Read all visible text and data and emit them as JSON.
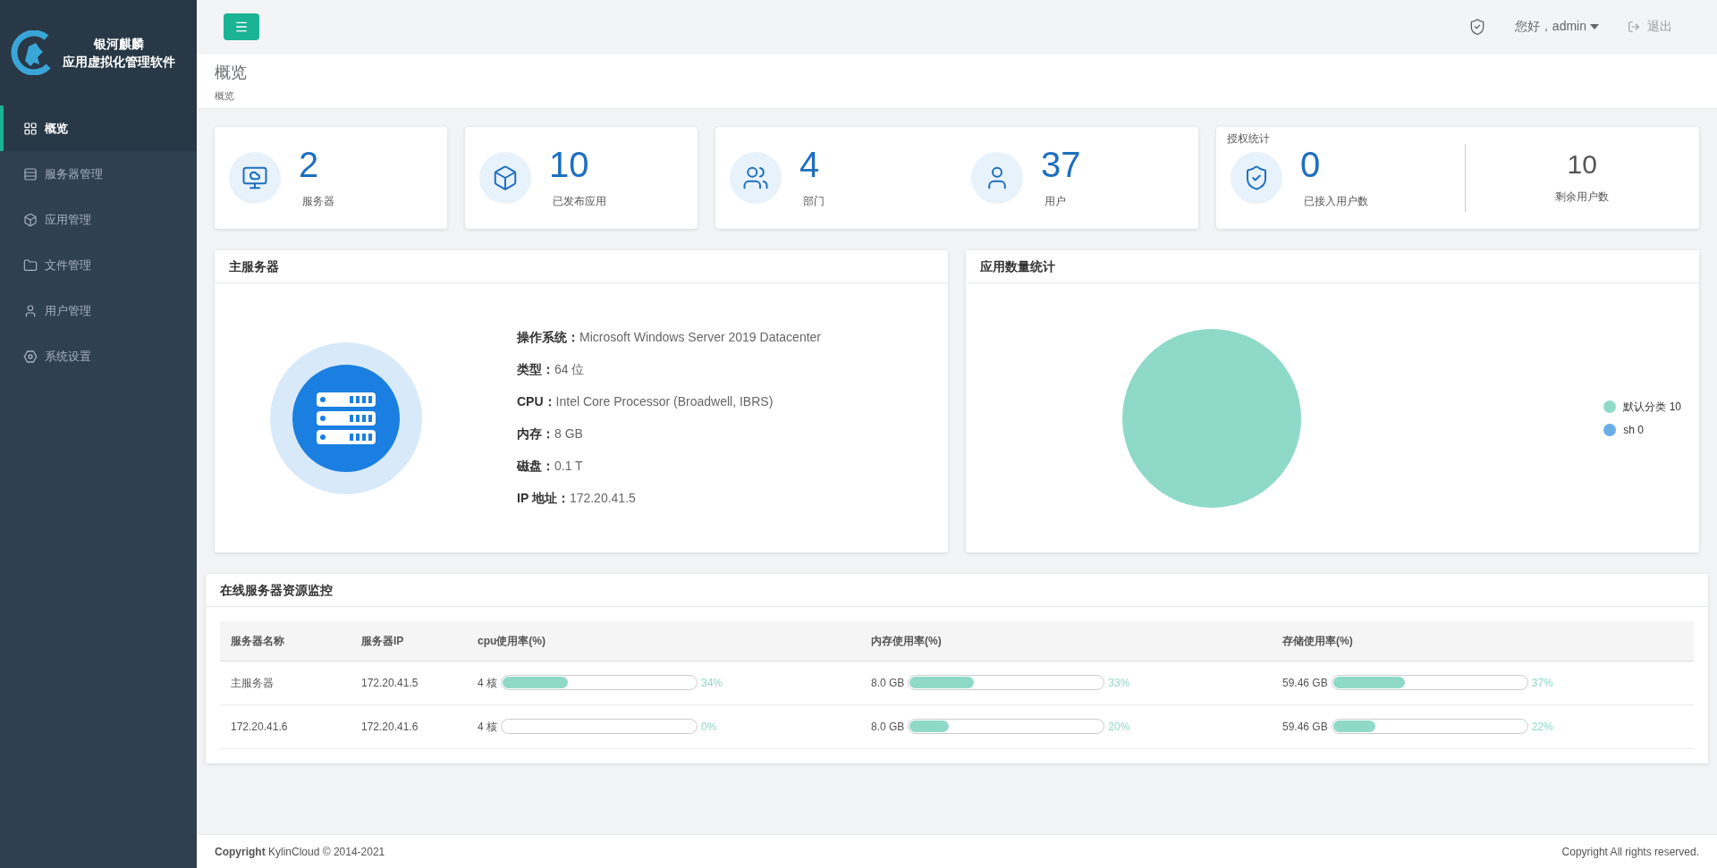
{
  "sidebar": {
    "brand_line_1": "银河麒麟",
    "brand_line_2": "应用虚拟化管理软件",
    "items": [
      {
        "label": "概览",
        "kind": "overview",
        "selected": true
      },
      {
        "label": "服务器管理",
        "kind": "server",
        "selected": false
      },
      {
        "label": "应用管理",
        "kind": "app",
        "selected": false
      },
      {
        "label": "文件管理",
        "kind": "file",
        "selected": false
      },
      {
        "label": "用户管理",
        "kind": "user",
        "selected": false
      },
      {
        "label": "系统设置",
        "kind": "settings",
        "selected": false
      }
    ]
  },
  "header": {
    "greeting": "您好，admin",
    "logout": "退出"
  },
  "page": {
    "title": "概览",
    "breadcrumb": "概览"
  },
  "stat_cards": [
    {
      "items": [
        {
          "kind": "server",
          "value": "2",
          "label": "服务器"
        }
      ]
    },
    {
      "items": [
        {
          "kind": "app",
          "value": "10",
          "label": "已发布应用"
        }
      ]
    },
    {
      "items": [
        {
          "kind": "department",
          "value": "4",
          "label": "部门"
        },
        {
          "kind": "user",
          "value": "37",
          "label": "用户"
        }
      ]
    },
    {
      "title": "授权统计",
      "items": [
        {
          "kind": "license",
          "value": "0",
          "label": "已接入用户数"
        },
        {
          "kind": "plain",
          "value": "10",
          "label": "剩余用户数"
        }
      ]
    }
  ],
  "main_server": {
    "title": "主服务器",
    "fields": [
      {
        "label": "操作系统：",
        "value": "Microsoft Windows Server 2019 Datacenter"
      },
      {
        "label": "类型：",
        "value": "64 位"
      },
      {
        "label": "CPU：",
        "value": "Intel Core Processor (Broadwell, IBRS)"
      },
      {
        "label": "内存：",
        "value": "8 GB"
      },
      {
        "label": "磁盘：",
        "value": "0.1 T"
      },
      {
        "label": "IP 地址：",
        "value": "172.20.41.5"
      }
    ]
  },
  "app_stats": {
    "title": "应用数量统计",
    "legend": [
      {
        "label": "默认分类 10",
        "color": "#8fd9c8"
      },
      {
        "label": "sh 0",
        "color": "#6aaee6"
      }
    ]
  },
  "monitor": {
    "title": "在线服务器资源监控",
    "columns": [
      "服务器名称",
      "服务器IP",
      "cpu使用率(%)",
      "内存使用率(%)",
      "存储使用率(%)"
    ],
    "rows": [
      {
        "name": "主服务器",
        "ip": "172.20.41.5",
        "meters": [
          {
            "amount": "4 核",
            "level": 0.34,
            "percent": "34%"
          },
          {
            "amount": "8.0 GB",
            "level": 0.33,
            "percent": "33%"
          },
          {
            "amount": "59.46 GB",
            "level": 0.37,
            "percent": "37%"
          }
        ]
      },
      {
        "name": "172.20.41.6",
        "ip": "172.20.41.6",
        "meters": [
          {
            "amount": "4 核",
            "level": 0,
            "percent": "0%"
          },
          {
            "amount": "8.0 GB",
            "level": 0.2,
            "percent": "20%"
          },
          {
            "amount": "59.46 GB",
            "level": 0.22,
            "percent": "22%"
          }
        ]
      }
    ]
  },
  "footer": {
    "left": "**Copyright** KylinCloud © 2014-2021",
    "right": "Copyright All rights reserved."
  }
}
